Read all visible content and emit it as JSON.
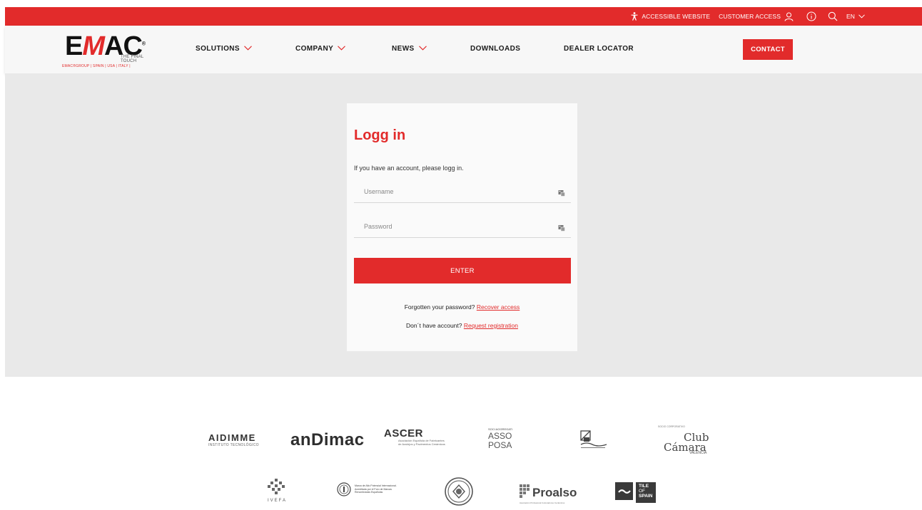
{
  "topbar": {
    "accessible_label": "ACCESSIBLE WEBSITE",
    "customer_access_label": "CUSTOMER ACCESS",
    "language_label": "EN"
  },
  "logo": {
    "brand_e": "E",
    "brand_m": "M",
    "brand_ac": "AC",
    "registered": "®",
    "tagline": "THE FINAL TOUCH",
    "group_line": "EMAC®GROUP | SPAIN | USA | ITALY |"
  },
  "nav": {
    "solutions": "SOLUTIONS",
    "company": "COMPANY",
    "news": "NEWS",
    "downloads": "DOWNLOADS",
    "dealer_locator": "DEALER LOCATOR",
    "contact": "CONTACT"
  },
  "login": {
    "title": "Logg in",
    "subtitle": "If you have an account, please logg in.",
    "username_placeholder": "Username",
    "password_placeholder": "Password",
    "enter_label": "ENTER",
    "forgot_text": "Forgotten your password?",
    "recover_link": "Recover access",
    "no_account_text": "Don´t have account?",
    "register_link": "Request registration"
  },
  "partners": {
    "aidimme": "AIDIMME",
    "aidimme_sub": "INSTITUTO TECNOLÓGICO",
    "andimac": "anDimac",
    "ascer": "ASCER",
    "ascer_sub": "Asociación Española de Fabricantes de Azulejos y Pavimentos Cerámicos",
    "assoposa_top": "SOCI AGGREGATI",
    "assoposa_1": "ASSO",
    "assoposa_2": "POSA",
    "club_top": "SOCIO CORPORATIVO",
    "club_1": "Club",
    "club_2": "Cámara",
    "club_3": "VALENCIA",
    "ivefa": "IVEFA",
    "mra": "Marca de Alto Potencial Internacional. Acreditada por el Foro de Marcas Renombradas Españolas",
    "proalso": "Proalso",
    "proalso_sub": "Asociación Profesional Colocadores Cerámicos",
    "tile_1": "TILE",
    "tile_2": "OF",
    "tile_3": "SPAIN"
  },
  "colors": {
    "brand_red": "#e22b2b",
    "band_gray": "#e9e9e9"
  }
}
